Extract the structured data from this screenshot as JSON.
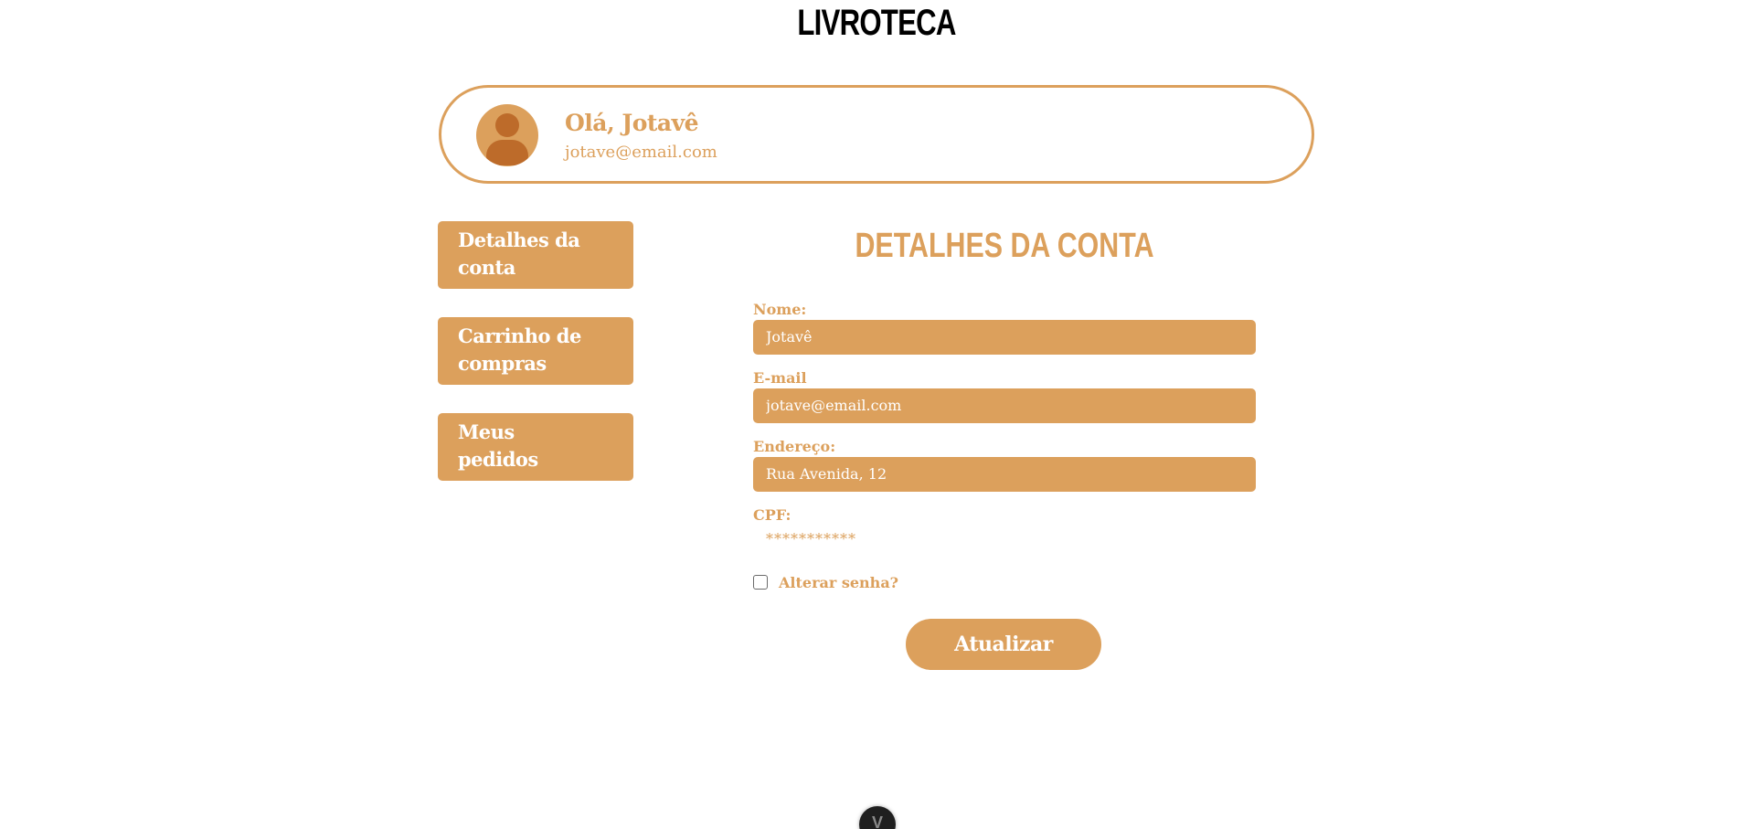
{
  "brand": {
    "name": "LIVROTECA"
  },
  "profile": {
    "greeting": "Olá, Jotavê",
    "email": "jotave@email.com",
    "avatar_icon": "user-avatar-icon"
  },
  "sidebar": {
    "items": [
      {
        "line1": "Detalhes da",
        "line2": "conta"
      },
      {
        "line1": "Carrinho de",
        "line2": "compras"
      },
      {
        "line1": "Meus",
        "line2": "pedidos"
      }
    ]
  },
  "main": {
    "title": "DETALHES DA CONTA",
    "fields": {
      "name": {
        "label": "Nome:",
        "value": "Jotavê"
      },
      "email": {
        "label": "E-mail",
        "value": "jotave@email.com"
      },
      "address": {
        "label": "Endereço:",
        "value": "Rua Avenida, 12"
      },
      "cpf": {
        "label": "CPF:",
        "value": "***********"
      }
    },
    "change_password_label": "Alterar senha?",
    "change_password_checked": false,
    "submit_label": "Atualizar"
  },
  "floating_widget": {
    "glyph": "V",
    "icon": "chevron-icon"
  },
  "colors": {
    "accent": "#dca05c",
    "accent_dark": "#bd6b2a",
    "text_dark": "#000000",
    "background": "#ffffff"
  }
}
